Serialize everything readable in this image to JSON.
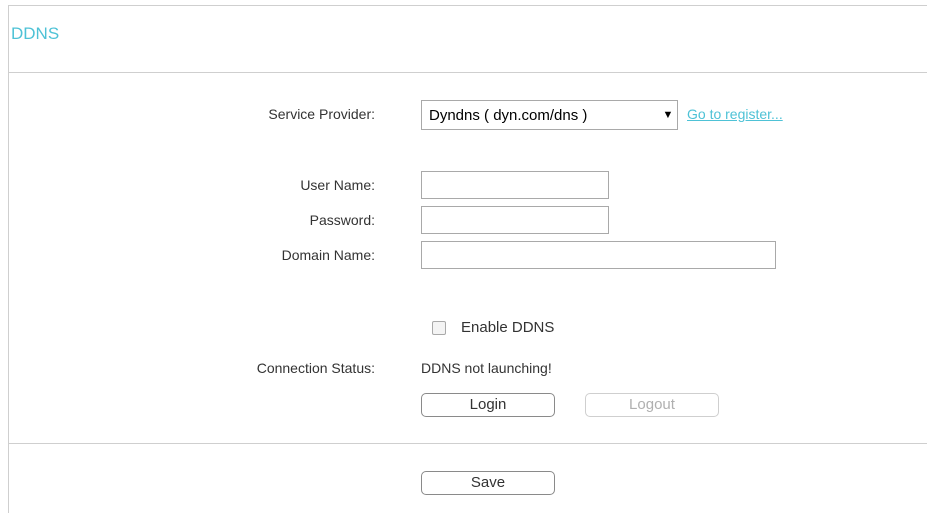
{
  "page": {
    "title": "DDNS"
  },
  "form": {
    "service_provider": {
      "label": "Service Provider:",
      "selected": "Dyndns ( dyn.com/dns )",
      "register_link": "Go to register..."
    },
    "user_name": {
      "label": "User Name:",
      "value": ""
    },
    "password": {
      "label": "Password:",
      "value": ""
    },
    "domain_name": {
      "label": "Domain Name:",
      "value": ""
    },
    "enable": {
      "label": "Enable DDNS",
      "checked": false
    },
    "connection_status": {
      "label": "Connection Status:",
      "value": "DDNS not launching!"
    },
    "login_label": "Login",
    "logout_label": "Logout"
  },
  "footer": {
    "save_label": "Save"
  },
  "colors": {
    "accent": "#4ec2d6",
    "border": "#cfcfcf"
  }
}
